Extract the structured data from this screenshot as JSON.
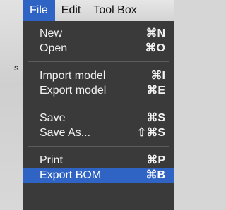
{
  "background": {
    "stray_text": "s"
  },
  "menubar": {
    "items": [
      {
        "label": "File",
        "active": true
      },
      {
        "label": "Edit",
        "active": false
      },
      {
        "label": "Tool Box",
        "active": false
      }
    ]
  },
  "file_menu": {
    "groups": [
      [
        {
          "label": "New",
          "shortcut": "⌘N"
        },
        {
          "label": "Open",
          "shortcut": "⌘O"
        }
      ],
      [
        {
          "label": "Import model",
          "shortcut": "⌘I"
        },
        {
          "label": "Export model",
          "shortcut": "⌘E"
        }
      ],
      [
        {
          "label": "Save",
          "shortcut": "⌘S"
        },
        {
          "label": "Save As...",
          "shortcut": "⇧⌘S"
        }
      ],
      [
        {
          "label": "Print",
          "shortcut": "⌘P"
        },
        {
          "label": "Export BOM",
          "shortcut": "⌘B",
          "highlighted": true
        }
      ]
    ]
  },
  "colors": {
    "accent": "#2f63c4",
    "menu_bg": "#3a3a3a",
    "menu_text": "#f2f2f2",
    "menubar_bg": "#dcdcdc"
  }
}
